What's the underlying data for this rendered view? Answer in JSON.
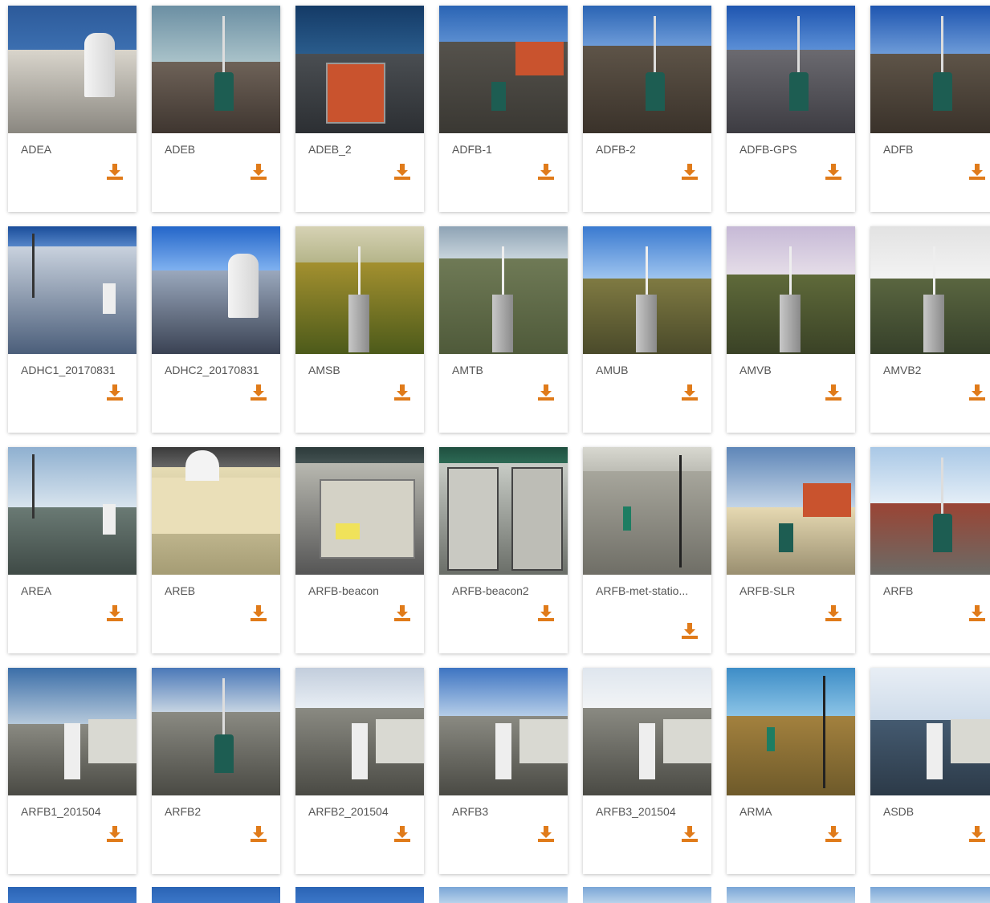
{
  "accent_color": "#e07b1a",
  "download_icon": "download-icon",
  "sites": [
    [
      "ADEA",
      "ADEB",
      "ADEB_2",
      "ADFB-1",
      "ADFB-2",
      "ADFB-GPS",
      "ADFB"
    ],
    [
      "ADHC1_20170831",
      "ADHC2_20170831",
      "AMSB",
      "AMTB",
      "AMUB",
      "AMVB",
      "AMVB2"
    ],
    [
      "AREA",
      "AREB",
      "ARFB-beacon",
      "ARFB-beacon2",
      "ARFB-met-statio...",
      "ARFB-SLR",
      "ARFB"
    ],
    [
      "ARFB1_201504",
      "ARFB2",
      "ARFB2_201504",
      "ARFB3",
      "ARFB3_201504",
      "ARMA",
      "ASDB"
    ]
  ]
}
